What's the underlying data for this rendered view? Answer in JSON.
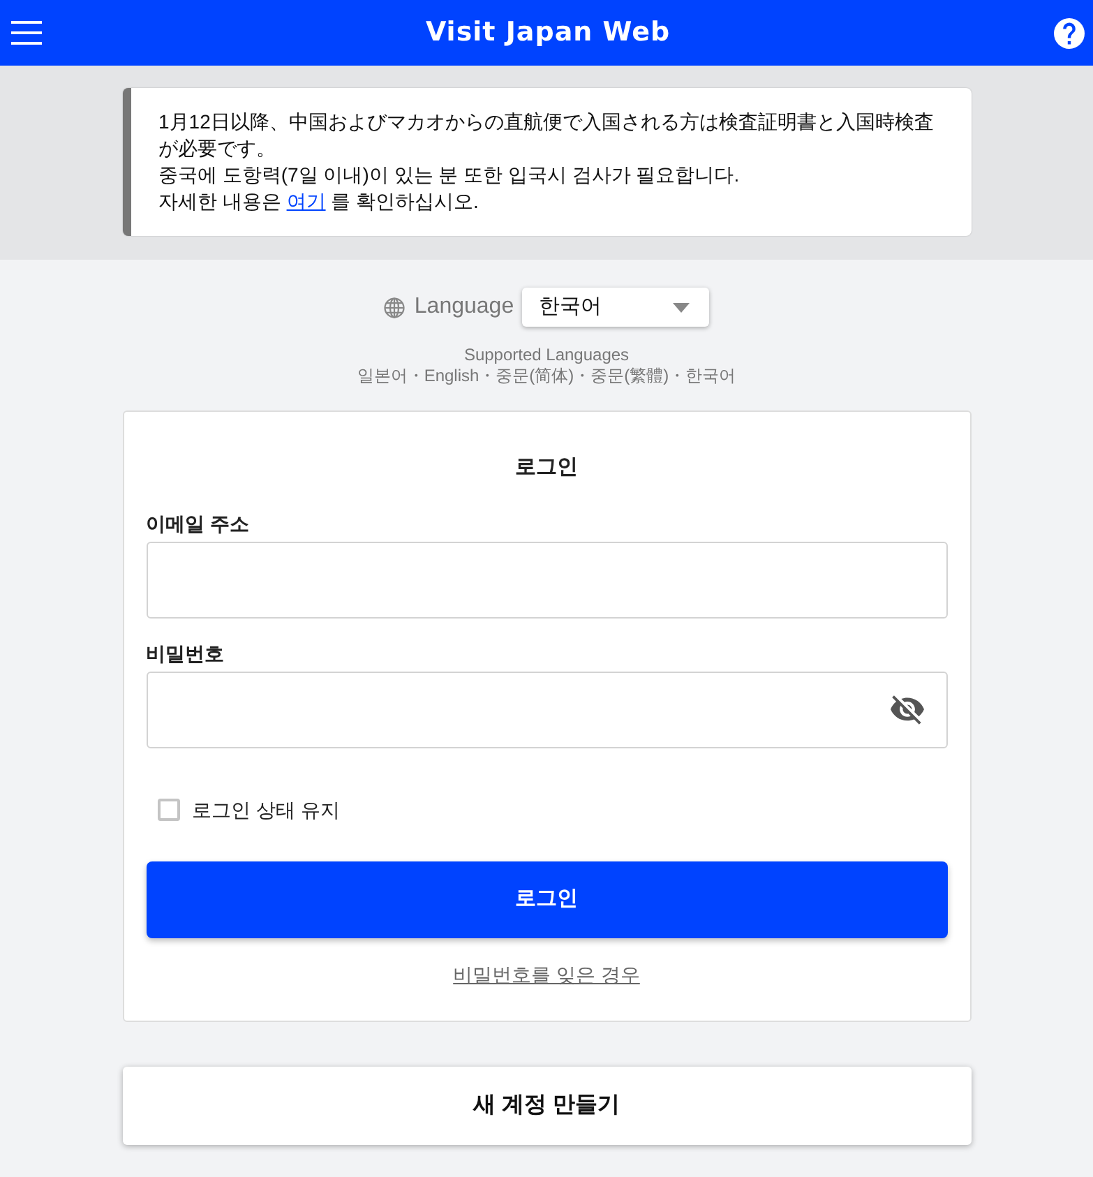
{
  "header": {
    "title": "Visit Japan Web"
  },
  "notice": {
    "lines": [
      "1月12日以降、中国およびマカオからの直航便で入国される方は検査証明書と入国時検査が必要です。",
      "중국에 도항력(7일 이내)이 있는 분 또한 입국시 검사가 필요합니다."
    ],
    "link_line": {
      "before": "자세한 내용은",
      "link": "여기",
      "after": "를 확인하십시오."
    }
  },
  "language": {
    "label": "Language",
    "value": "한국어",
    "supported_title": "Supported Languages",
    "supported_list": "일본어・English・중문(简体)・중문(繁體)・한국어"
  },
  "login": {
    "title": "로그인",
    "fields": [
      {
        "label": "이메일 주소",
        "kind": "text"
      },
      {
        "label": "비밀번호",
        "kind": "password"
      }
    ],
    "remember": {
      "label": "로그인 상태 유지",
      "checked": false
    },
    "submit": "로그인",
    "forgot_link": "비밀번호를 잊은 경우"
  },
  "create_account": "새 계정 만들기"
}
